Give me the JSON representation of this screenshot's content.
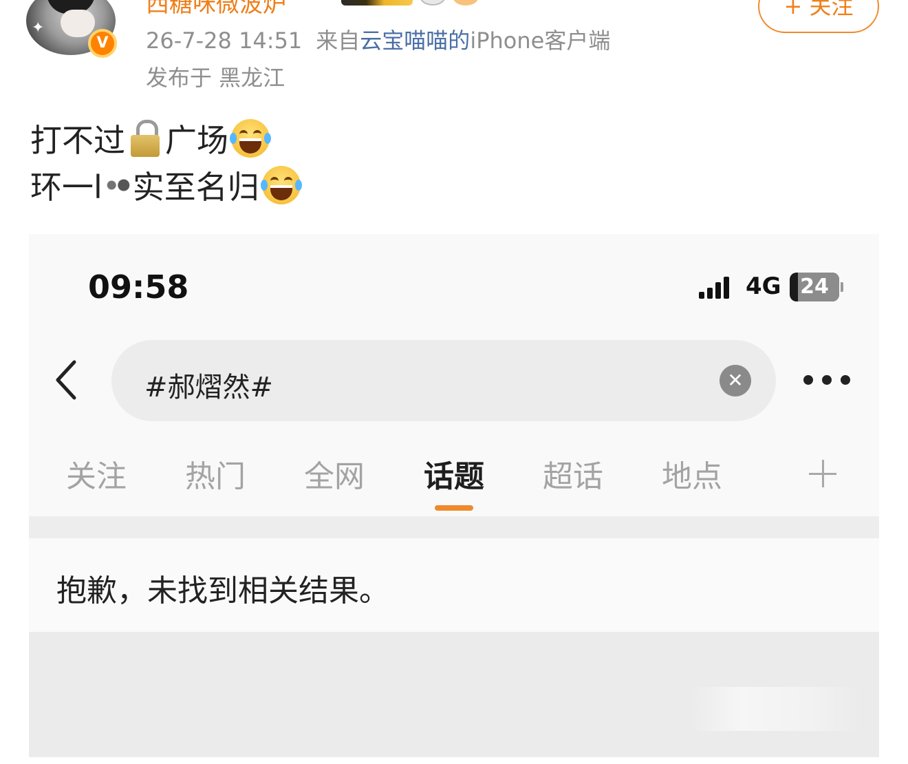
{
  "post": {
    "username": "西糖咪微波炉",
    "meta": {
      "time": "26-7-28 14:51",
      "source_prefix": "来自",
      "source_name": "云宝喵喵的",
      "source_device": "iPhone客户端"
    },
    "location": "发布于 黑龙江",
    "follow_label": "+ 关注",
    "badge_letter": "V",
    "text": {
      "line1_before": "打不过",
      "line1_after": "广场",
      "line2_before": "环一l",
      "line2_after": "实至名归"
    },
    "icons": {
      "lock": "lock-icon",
      "laugh": "laughing-tears-emoji"
    },
    "colors": {
      "username": "#ef7f1a",
      "follow": "#ef7f1a",
      "source_link": "#4a6fa5",
      "verified_badge": "#ff8200"
    }
  },
  "screenshot": {
    "status_bar": {
      "time": "09:58",
      "network": "4G",
      "battery": "24"
    },
    "search": {
      "query": "#郝熠然#"
    },
    "tabs": [
      {
        "label": "关注",
        "active": false
      },
      {
        "label": "热门",
        "active": false
      },
      {
        "label": "全网",
        "active": false
      },
      {
        "label": "话题",
        "active": true
      },
      {
        "label": "超话",
        "active": false
      },
      {
        "label": "地点",
        "active": false
      }
    ],
    "empty_message": "抱歉，未找到相关结果。",
    "accent_color": "#ef8a2c"
  }
}
